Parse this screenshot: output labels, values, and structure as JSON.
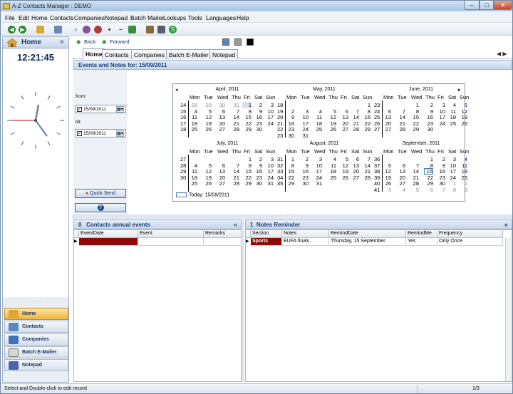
{
  "window": {
    "title": "A-Z Contacts Manager : DEMO"
  },
  "menu": [
    "File",
    "Edit",
    "Home",
    "Contacts",
    "Companies",
    "Notepad",
    "Batch Mailer",
    "Lookups",
    "Tools",
    "Languages",
    "Help"
  ],
  "left": {
    "header": "Home",
    "chevron": "«",
    "time": "12:21:45",
    "nav": [
      "Home",
      "Contacts",
      "Companies",
      "Batch E-Mailer",
      "Notepad"
    ]
  },
  "navrow": {
    "back": "Back",
    "forward": "Forward"
  },
  "colors": {
    "swatch1": "#5a86c8",
    "swatch2": "#9a9a9a",
    "swatch3": "#000000",
    "accent": "#1c3f75",
    "active_nav": "#f0b33b",
    "sports_row": "#8b0a0a"
  },
  "tabs": [
    "Home",
    "Contacts",
    "Companies",
    "Batch E-Mailer",
    "Notepad"
  ],
  "events": {
    "header": "Events and Notes for:  15/09/2011",
    "from_label": "from:",
    "till_label": "till:",
    "from_value": "15/09/2011",
    "till_value": "15/09/2011",
    "quick_send": "Quick Send",
    "help": "?"
  },
  "calendar": {
    "weekdays": [
      "Mon",
      "Tue",
      "Wed",
      "Thu",
      "Fri",
      "Sat",
      "Sun"
    ],
    "today_label": "Today: 15/09/2011",
    "months": [
      {
        "title": "April, 2011",
        "weeks": [
          "14",
          "15",
          "16",
          "17",
          "18"
        ],
        "rows": [
          [
            "28",
            "29",
            "30",
            "31",
            "1",
            "2",
            "3"
          ],
          [
            "4",
            "5",
            "6",
            "7",
            "8",
            "9",
            "10"
          ],
          [
            "11",
            "12",
            "13",
            "14",
            "15",
            "16",
            "17"
          ],
          [
            "18",
            "19",
            "20",
            "21",
            "22",
            "23",
            "24"
          ],
          [
            "25",
            "26",
            "27",
            "28",
            "29",
            "30",
            ""
          ]
        ]
      },
      {
        "title": "May, 2011",
        "weeks": [
          "18",
          "19",
          "20",
          "21",
          "22"
        ],
        "rows": [
          [
            "",
            "",
            "",
            "",
            "",
            "",
            "1"
          ],
          [
            "2",
            "3",
            "4",
            "5",
            "6",
            "7",
            "8"
          ],
          [
            "9",
            "10",
            "11",
            "12",
            "13",
            "14",
            "15"
          ],
          [
            "16",
            "17",
            "18",
            "19",
            "20",
            "21",
            "22"
          ],
          [
            "23",
            "24",
            "25",
            "26",
            "27",
            "28",
            "29"
          ],
          [
            "30",
            "31",
            "",
            "",
            "",
            "",
            ""
          ]
        ],
        "extraweek": "23"
      },
      {
        "title": "June, 2011",
        "weeks": [
          "23",
          "24",
          "25",
          "26",
          "27"
        ],
        "rows": [
          [
            "",
            "",
            "1",
            "2",
            "3",
            "4",
            "5"
          ],
          [
            "6",
            "7",
            "8",
            "9",
            "10",
            "11",
            "12"
          ],
          [
            "13",
            "14",
            "15",
            "16",
            "17",
            "18",
            "19"
          ],
          [
            "20",
            "21",
            "22",
            "23",
            "24",
            "25",
            "26"
          ],
          [
            "27",
            "28",
            "29",
            "30",
            "",
            "",
            ""
          ]
        ]
      },
      {
        "title": "July, 2011",
        "weeks": [
          "27",
          "28",
          "29",
          "30"
        ],
        "rows": [
          [
            "",
            "",
            "",
            "",
            "1",
            "2",
            "3"
          ],
          [
            "4",
            "5",
            "6",
            "7",
            "8",
            "9",
            "10"
          ],
          [
            "11",
            "12",
            "13",
            "14",
            "15",
            "16",
            "17"
          ],
          [
            "18",
            "19",
            "20",
            "21",
            "22",
            "23",
            "24"
          ],
          [
            "25",
            "26",
            "27",
            "28",
            "29",
            "30",
            "31"
          ]
        ]
      },
      {
        "title": "August, 2011",
        "weeks": [
          "31",
          "32",
          "33",
          "34",
          "35",
          "36"
        ],
        "rows": [
          [
            "1",
            "2",
            "3",
            "4",
            "5",
            "6",
            "7"
          ],
          [
            "8",
            "9",
            "10",
            "11",
            "12",
            "13",
            "14"
          ],
          [
            "15",
            "16",
            "17",
            "18",
            "19",
            "20",
            "21"
          ],
          [
            "22",
            "23",
            "24",
            "25",
            "26",
            "27",
            "28"
          ],
          [
            "29",
            "30",
            "31",
            "",
            "",
            "",
            ""
          ]
        ]
      },
      {
        "title": "September, 2011",
        "weeks": [
          "36",
          "37",
          "38",
          "39",
          "40",
          "41"
        ],
        "rows": [
          [
            "",
            "",
            "",
            "1",
            "2",
            "3",
            "4"
          ],
          [
            "5",
            "6",
            "7",
            "8",
            "9",
            "10",
            "11"
          ],
          [
            "12",
            "13",
            "14",
            "15",
            "16",
            "17",
            "18"
          ],
          [
            "19",
            "20",
            "21",
            "22",
            "23",
            "24",
            "25"
          ],
          [
            "26",
            "27",
            "28",
            "29",
            "30",
            "1",
            "2"
          ],
          [
            "3",
            "4",
            "5",
            "6",
            "7",
            "8",
            "9"
          ]
        ]
      }
    ]
  },
  "annual": {
    "count": "0",
    "title": "Contacts annual events",
    "columns": [
      "EventDate",
      "Event",
      "Remarks"
    ]
  },
  "notes": {
    "count": "1",
    "title": "Notes Reminder",
    "columns": [
      "Section",
      "Notes",
      "RemindDate",
      "RemindMe",
      "Frequency"
    ],
    "rows": [
      [
        "Sports",
        "EUFA finals",
        "Thursday, 15 September",
        "Yes",
        "Only Once"
      ]
    ]
  },
  "status": {
    "text": "Select and Double-click to edit record",
    "page": "1/3"
  }
}
